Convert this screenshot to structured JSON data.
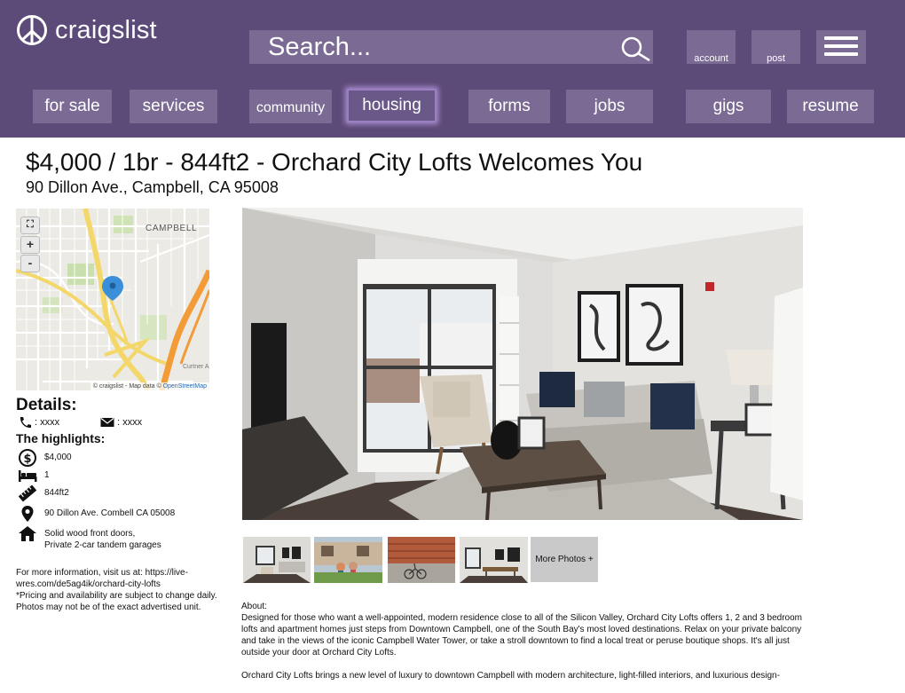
{
  "brand": {
    "name": "craigslist"
  },
  "search": {
    "placeholder": "Search..."
  },
  "toolbar": {
    "account_label": "account",
    "post_label": "post"
  },
  "nav": [
    {
      "label": "for sale",
      "active": false
    },
    {
      "label": "services",
      "active": false
    },
    {
      "label": "community",
      "active": false
    },
    {
      "label": "housing",
      "active": true
    },
    {
      "label": "forms",
      "active": false
    },
    {
      "label": "jobs",
      "active": false
    },
    {
      "label": "gigs",
      "active": false
    },
    {
      "label": "resume",
      "active": false
    }
  ],
  "listing": {
    "title": "$4,000 / 1br - 844ft2 - Orchard City Lofts Welcomes You",
    "address": "90 Dillon Ave., Campbell, CA 95008"
  },
  "map": {
    "town_label": "CAMPBELL",
    "corner_label": "Curtner A",
    "attribution_prefix": "© craigslist - Map data ©",
    "attribution_link": "OpenStreetMap",
    "controls": {
      "fullscreen": "⛶",
      "zoom_in": "+",
      "zoom_out": "-"
    }
  },
  "details": {
    "heading": "Details:",
    "phone": ": xxxx",
    "email": ": xxxx",
    "highlights_heading": "The highlights:",
    "highlights": [
      {
        "icon": "dollar-icon",
        "text": "$4,000"
      },
      {
        "icon": "bed-icon",
        "text": "1"
      },
      {
        "icon": "ruler-icon",
        "text": "844ft2"
      },
      {
        "icon": "location-pin-icon",
        "text": "90 Dillon Ave. Combell CA 05008"
      },
      {
        "icon": "house-icon",
        "line1": "Solid wood front doors,",
        "line2": "Private 2-car tandem garages"
      }
    ],
    "more_info": {
      "line1": "For more information, visit us at: https://live-",
      "line2": "wres.com/de5ag4ik/orchard-city-lofts",
      "line3": "*Pricing and availability are subject to change daily.",
      "line4": "Photos may not be of the exact advertised unit."
    }
  },
  "photos": {
    "more_label": "More Photos +"
  },
  "about": {
    "heading": "About:",
    "paragraph1": "Designed for those who want a well-appointed, modern residence close to all of the Silicon Valley, Orchard City Lofts offers 1, 2 and 3 bedroom lofts and apartment homes just steps from Downtown Campbell, one of the South Bay's most loved destinations. Relax on your private balcony and take in the views of the iconic Campbell Water Tower, or take a stroll downtown to find a local treat or peruse boutique shops. It's all just outside your door at Orchard City Lofts.",
    "paragraph2": "Orchard City Lofts brings a new level of luxury to downtown Campbell with modern architecture, light-filled interiors, and luxurious design-"
  },
  "colors": {
    "header_bg": "#5c4a78",
    "button_bg": "#7a6a94",
    "active_glow": "#a88fce"
  }
}
